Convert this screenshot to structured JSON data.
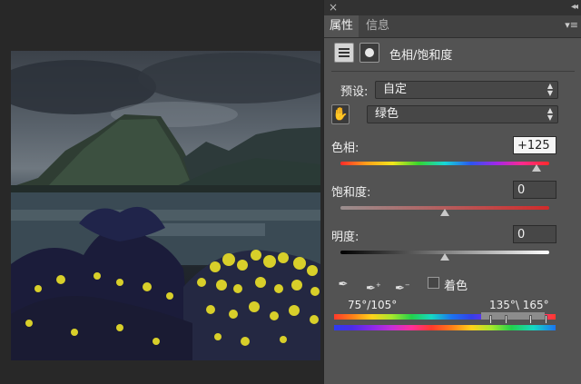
{
  "panel": {
    "tabs": [
      {
        "label": "属性",
        "active": true
      },
      {
        "label": "信息",
        "active": false
      }
    ],
    "title": "色相/饱和度"
  },
  "controls": {
    "preset": {
      "label": "预设:",
      "value": "自定"
    },
    "channel": {
      "value": "绿色"
    },
    "hue": {
      "label": "色相:",
      "value": "+125",
      "fraction": 0.94
    },
    "saturation": {
      "label": "饱和度:",
      "value": "0",
      "fraction": 0.5
    },
    "lightness": {
      "label": "明度:",
      "value": "0",
      "fraction": 0.5
    },
    "colorize": {
      "label": "着色",
      "checked": false
    },
    "range": {
      "left": "75°/105°",
      "right": "135°\\ 165°"
    }
  },
  "icons": {
    "close": "close-icon",
    "collapse": "collapse-icon",
    "menu": "panel-menu-icon",
    "adjustment": "hue-saturation-adjustment-icon",
    "mask": "layer-mask-icon",
    "hand": "targeted-adjustment-hand-icon",
    "eyedropper": "eyedropper-icon",
    "eyedropper_add": "eyedropper-plus-icon",
    "eyedropper_subtract": "eyedropper-minus-icon"
  },
  "colors": {
    "panel_bg": "#535353",
    "canvas_bg": "#282828"
  }
}
